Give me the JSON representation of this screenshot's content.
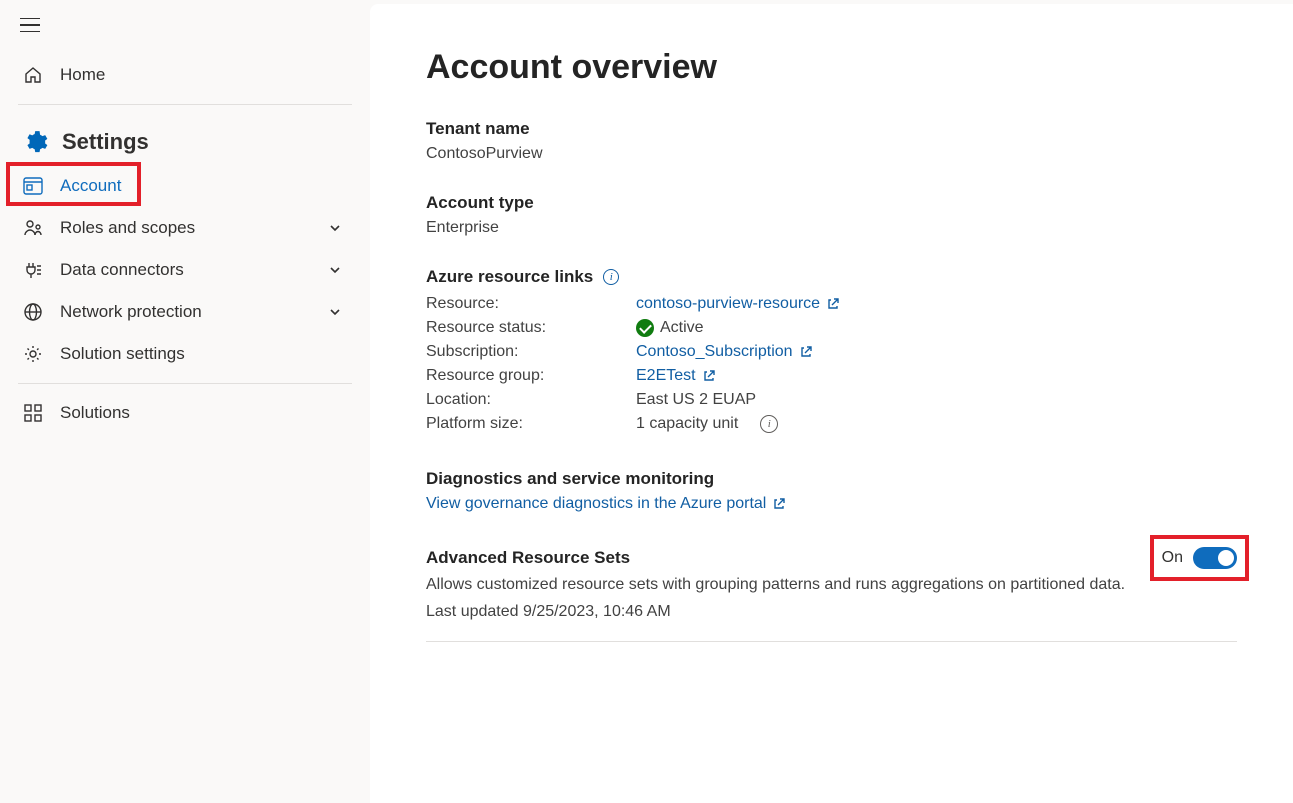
{
  "sidebar": {
    "home": "Home",
    "settings_header": "Settings",
    "items": {
      "account": "Account",
      "roles": "Roles and scopes",
      "connectors": "Data connectors",
      "network": "Network protection",
      "solution_settings": "Solution settings",
      "solutions": "Solutions"
    }
  },
  "main": {
    "title": "Account overview",
    "tenant_name_label": "Tenant name",
    "tenant_name_value": "ContosoPurview",
    "account_type_label": "Account type",
    "account_type_value": "Enterprise",
    "azure_links_header": "Azure resource links",
    "resources": {
      "resource_key": "Resource:",
      "resource_link": "contoso-purview-resource",
      "status_key": "Resource status:",
      "status_value": "Active",
      "subscription_key": "Subscription:",
      "subscription_link": "Contoso_Subscription",
      "rg_key": "Resource group:",
      "rg_link": "E2ETest",
      "location_key": "Location:",
      "location_value": "East US 2 EUAP",
      "platform_key": "Platform size:",
      "platform_value": "1 capacity unit"
    },
    "diag_header": "Diagnostics and service monitoring",
    "diag_link": "View governance diagnostics in the Azure portal",
    "ars_header": "Advanced Resource Sets",
    "ars_toggle_label": "On",
    "ars_desc": "Allows customized resource sets with grouping patterns and runs aggregations on partitioned data.",
    "ars_updated": "Last updated 9/25/2023, 10:46 AM"
  }
}
